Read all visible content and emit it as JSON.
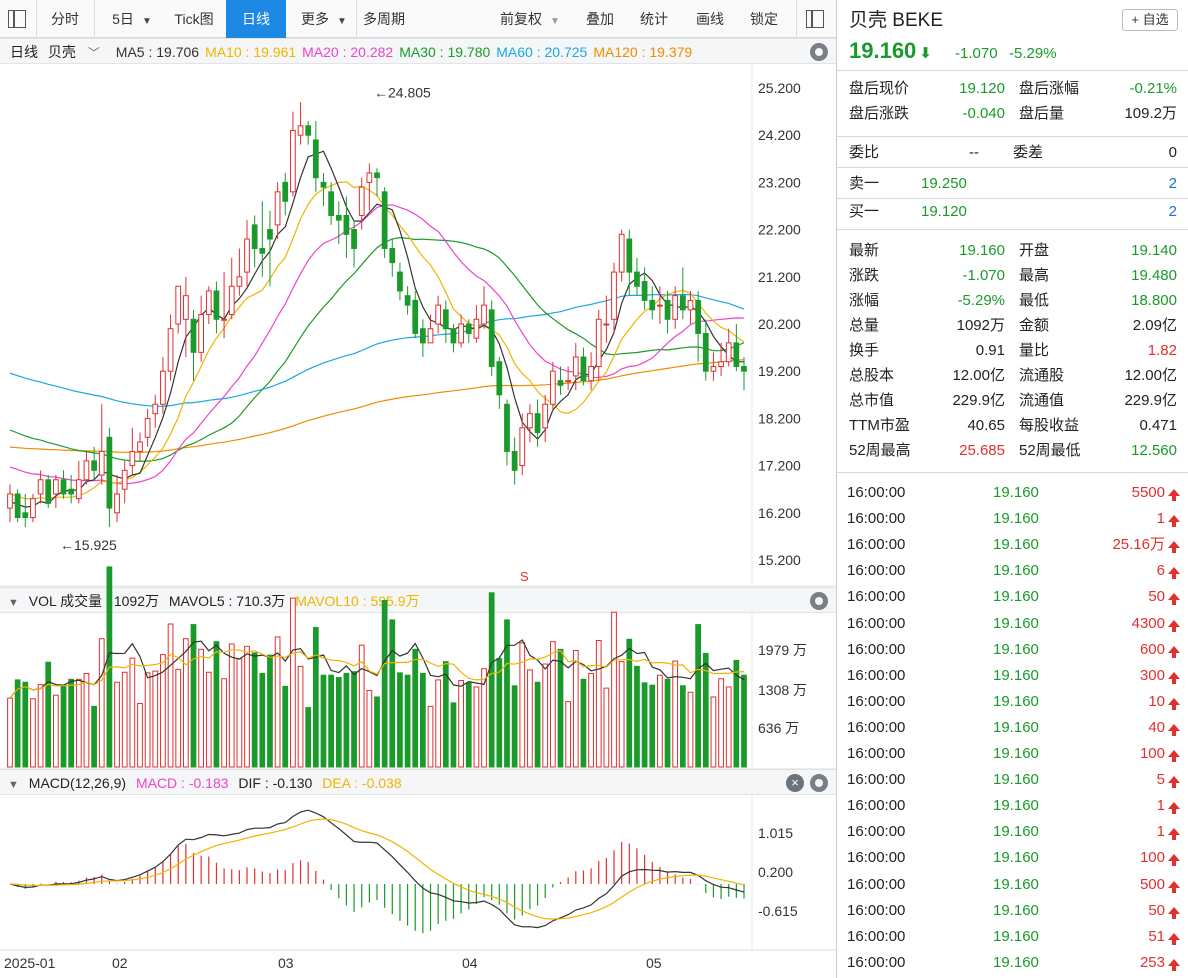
{
  "toolbar": {
    "items": [
      "分时",
      "5日",
      "Tick图",
      "日线",
      "更多",
      "多周期",
      "前复权",
      "叠加",
      "统计",
      "画线",
      "锁定"
    ],
    "active": "日线"
  },
  "kline": {
    "period_label": "日线",
    "stock_label": "贝壳",
    "ma": [
      {
        "label": "MA5 : 19.706",
        "color": "#333333"
      },
      {
        "label": "MA10 : 19.961",
        "color": "#f0b400"
      },
      {
        "label": "MA20 : 20.282",
        "color": "#ee44cc"
      },
      {
        "label": "MA30 : 19.780",
        "color": "#1a9a2a"
      },
      {
        "label": "MA60 : 20.725",
        "color": "#1ba8e0"
      },
      {
        "label": "MA120 : 19.379",
        "color": "#f08c00"
      }
    ],
    "price_ticks": [
      "25.200",
      "24.200",
      "23.200",
      "22.200",
      "21.200",
      "20.200",
      "19.200",
      "18.200",
      "17.200",
      "16.200",
      "15.200"
    ],
    "high_note": "←24.805",
    "low_note": "←15.925",
    "s_marker": "S"
  },
  "vol": {
    "title": "VOL 成交量 : 1092万",
    "mavol5": "MAVOL5 : 710.3万",
    "mavol10": "MAVOL10 : 595.9万",
    "ticks": [
      "1979 万",
      "1308 万",
      "636 万"
    ]
  },
  "macd": {
    "title": "MACD(12,26,9)",
    "macd": "MACD : -0.183",
    "dif": "DIF : -0.130",
    "dea": "DEA : -0.038",
    "ticks": [
      "1.015",
      "0.200",
      "-0.615"
    ]
  },
  "x_labels": [
    "2025-01",
    "02",
    "03",
    "04",
    "05"
  ],
  "colors": {
    "up": "#e03030",
    "down": "#1a9a2a",
    "accent": "#1e88e5"
  },
  "chart_data": {
    "type": "candlestick",
    "ylim": [
      15.2,
      25.2
    ],
    "candles": [
      [
        16.3,
        16.6,
        16.8,
        16.0
      ],
      [
        16.6,
        16.1,
        16.7,
        16.0
      ],
      [
        16.2,
        16.1,
        16.6,
        15.9
      ],
      [
        16.1,
        16.5,
        16.6,
        16.0
      ],
      [
        16.6,
        16.9,
        17.1,
        16.4
      ],
      [
        16.9,
        16.4,
        17.0,
        16.3
      ],
      [
        16.6,
        16.9,
        17.0,
        16.3
      ],
      [
        16.9,
        16.6,
        17.1,
        16.5
      ],
      [
        16.7,
        16.6,
        17.0,
        16.4
      ],
      [
        16.5,
        16.9,
        17.3,
        16.4
      ],
      [
        16.9,
        17.3,
        17.5,
        16.8
      ],
      [
        17.3,
        17.1,
        17.6,
        16.9
      ],
      [
        17.0,
        17.5,
        18.5,
        16.8
      ],
      [
        17.8,
        16.3,
        18.0,
        15.9
      ],
      [
        16.2,
        16.6,
        17.0,
        16.0
      ],
      [
        16.7,
        17.1,
        17.3,
        16.4
      ],
      [
        17.2,
        17.5,
        18.0,
        17.0
      ],
      [
        17.5,
        17.7,
        17.9,
        17.3
      ],
      [
        17.8,
        18.2,
        18.4,
        17.6
      ],
      [
        18.3,
        18.5,
        18.7,
        18.0
      ],
      [
        18.5,
        19.2,
        19.5,
        18.3
      ],
      [
        19.2,
        20.1,
        20.4,
        19.0
      ],
      [
        20.2,
        21.0,
        21.0,
        20.0
      ],
      [
        20.3,
        20.8,
        21.2,
        19.5
      ],
      [
        20.3,
        19.6,
        20.5,
        19.0
      ],
      [
        19.6,
        20.4,
        20.8,
        19.4
      ],
      [
        20.4,
        20.9,
        21.0,
        20.2
      ],
      [
        20.9,
        20.3,
        21.1,
        20.0
      ],
      [
        20.3,
        20.3,
        21.3,
        19.9
      ],
      [
        20.4,
        21.0,
        21.6,
        20.3
      ],
      [
        21.0,
        21.2,
        21.8,
        20.8
      ],
      [
        21.3,
        22.0,
        22.4,
        21.0
      ],
      [
        22.3,
        21.8,
        22.5,
        21.4
      ],
      [
        21.8,
        21.7,
        22.8,
        21.2
      ],
      [
        22.2,
        22.0,
        22.6,
        21.0
      ],
      [
        22.3,
        23.0,
        23.2,
        22.0
      ],
      [
        23.2,
        22.8,
        23.4,
        22.5
      ],
      [
        23.0,
        24.3,
        24.7,
        22.9
      ],
      [
        24.2,
        24.4,
        24.9,
        24.0
      ],
      [
        24.4,
        24.2,
        24.5,
        24.0
      ],
      [
        24.1,
        23.3,
        24.5,
        23.0
      ],
      [
        23.2,
        23.1,
        23.4,
        22.7
      ],
      [
        23.0,
        22.5,
        23.2,
        22.3
      ],
      [
        22.5,
        22.4,
        22.8,
        21.9
      ],
      [
        22.5,
        22.1,
        22.9,
        21.6
      ],
      [
        22.2,
        21.8,
        22.4,
        21.4
      ],
      [
        22.5,
        23.1,
        23.3,
        22.2
      ],
      [
        23.2,
        23.4,
        23.6,
        22.6
      ],
      [
        23.4,
        23.3,
        23.5,
        22.9
      ],
      [
        23.0,
        21.8,
        23.1,
        21.6
      ],
      [
        21.8,
        21.5,
        22.0,
        21.2
      ],
      [
        21.3,
        20.9,
        21.5,
        20.7
      ],
      [
        20.8,
        20.6,
        21.0,
        20.4
      ],
      [
        20.7,
        20.0,
        20.9,
        19.9
      ],
      [
        20.1,
        19.8,
        20.3,
        19.5
      ],
      [
        19.8,
        20.1,
        20.4,
        19.8
      ],
      [
        20.2,
        20.6,
        20.8,
        20.0
      ],
      [
        20.5,
        20.1,
        20.7,
        19.8
      ],
      [
        20.1,
        19.8,
        20.2,
        19.6
      ],
      [
        19.8,
        20.2,
        20.4,
        19.7
      ],
      [
        20.2,
        20.0,
        20.3,
        19.8
      ],
      [
        19.9,
        20.3,
        20.6,
        19.8
      ],
      [
        20.2,
        20.6,
        21.0,
        20.1
      ],
      [
        20.5,
        19.3,
        20.7,
        19.1
      ],
      [
        19.4,
        18.7,
        19.5,
        18.4
      ],
      [
        18.5,
        17.5,
        18.6,
        17.2
      ],
      [
        17.5,
        17.1,
        17.8,
        16.8
      ],
      [
        17.2,
        18.0,
        18.3,
        17.0
      ],
      [
        18.0,
        18.3,
        18.5,
        17.7
      ],
      [
        18.3,
        17.9,
        18.6,
        17.6
      ],
      [
        18.0,
        18.5,
        18.7,
        17.7
      ],
      [
        18.5,
        19.2,
        19.4,
        18.4
      ],
      [
        19.0,
        18.9,
        19.3,
        18.7
      ],
      [
        19.0,
        19.0,
        19.3,
        18.8
      ],
      [
        19.1,
        19.5,
        19.8,
        18.8
      ],
      [
        19.5,
        19.0,
        19.7,
        18.9
      ],
      [
        19.0,
        19.3,
        19.6,
        18.8
      ],
      [
        19.3,
        20.3,
        20.5,
        19.0
      ],
      [
        20.2,
        20.2,
        20.8,
        19.8
      ],
      [
        20.3,
        21.3,
        21.5,
        20.0
      ],
      [
        21.3,
        22.1,
        22.2,
        21.1
      ],
      [
        22.0,
        21.3,
        22.2,
        20.8
      ],
      [
        21.3,
        21.0,
        21.6,
        20.8
      ],
      [
        21.1,
        20.7,
        21.4,
        20.5
      ],
      [
        20.7,
        20.5,
        21.0,
        20.3
      ],
      [
        20.6,
        20.6,
        21.0,
        20.2
      ],
      [
        20.7,
        20.3,
        20.9,
        20.0
      ],
      [
        20.3,
        20.8,
        21.0,
        20.1
      ],
      [
        20.8,
        20.5,
        21.4,
        20.3
      ],
      [
        20.5,
        20.7,
        20.9,
        20.2
      ],
      [
        20.7,
        20.0,
        20.9,
        19.4
      ],
      [
        20.0,
        19.2,
        20.3,
        19.0
      ],
      [
        19.2,
        19.3,
        19.6,
        19.0
      ],
      [
        19.3,
        19.4,
        19.8,
        19.1
      ],
      [
        19.4,
        19.8,
        20.1,
        19.3
      ],
      [
        19.8,
        19.3,
        20.2,
        19.2
      ],
      [
        19.3,
        19.2,
        19.5,
        18.8
      ]
    ],
    "volume_ticks": [
      1979,
      1308,
      636
    ]
  },
  "panel": {
    "name": "贝壳",
    "symbol": "BEKE",
    "add_fav": "+ 自选",
    "price": "19.160",
    "change": "-1.070",
    "change_pct": "-5.29%",
    "after": [
      {
        "l1": "盘后现价",
        "v1": "19.120",
        "c1": "green",
        "l2": "盘后涨幅",
        "v2": "-0.21%",
        "c2": "green"
      },
      {
        "l1": "盘后涨跌",
        "v1": "-0.040",
        "c1": "green",
        "l2": "盘后量",
        "v2": "109.2万",
        "c2": ""
      }
    ],
    "weibi": {
      "l1": "委比",
      "v1": "--",
      "l2": "委差",
      "v2": "0"
    },
    "sell1": {
      "label": "卖一",
      "price": "19.250",
      "vol": "2"
    },
    "buy1": {
      "label": "买一",
      "price": "19.120",
      "vol": "2"
    },
    "stats": [
      {
        "l1": "最新",
        "v1": "19.160",
        "c1": "green",
        "l2": "开盘",
        "v2": "19.140",
        "c2": "green"
      },
      {
        "l1": "涨跌",
        "v1": "-1.070",
        "c1": "green",
        "l2": "最高",
        "v2": "19.480",
        "c2": "green"
      },
      {
        "l1": "涨幅",
        "v1": "-5.29%",
        "c1": "green",
        "l2": "最低",
        "v2": "18.800",
        "c2": "green"
      },
      {
        "l1": "总量",
        "v1": "1092万",
        "c1": "",
        "l2": "金额",
        "v2": "2.09亿",
        "c2": ""
      },
      {
        "l1": "换手",
        "v1": "0.91",
        "c1": "",
        "l2": "量比",
        "v2": "1.82",
        "c2": "red"
      },
      {
        "l1": "总股本",
        "v1": "12.00亿",
        "c1": "",
        "l2": "流通股",
        "v2": "12.00亿",
        "c2": ""
      },
      {
        "l1": "总市值",
        "v1": "229.9亿",
        "c1": "",
        "l2": "流通值",
        "v2": "229.9亿",
        "c2": ""
      },
      {
        "l1": "TTM市盈",
        "v1": "40.65",
        "c1": "",
        "l2": "每股收益",
        "v2": "0.471",
        "c2": ""
      },
      {
        "l1": "52周最高",
        "v1": "25.685",
        "c1": "red",
        "l2": "52周最低",
        "v2": "12.560",
        "c2": "green"
      }
    ],
    "ticks": [
      {
        "time": "16:00:00",
        "price": "19.160",
        "vol": "5500"
      },
      {
        "time": "16:00:00",
        "price": "19.160",
        "vol": "1"
      },
      {
        "time": "16:00:00",
        "price": "19.160",
        "vol": "25.16万"
      },
      {
        "time": "16:00:00",
        "price": "19.160",
        "vol": "6"
      },
      {
        "time": "16:00:00",
        "price": "19.160",
        "vol": "50"
      },
      {
        "time": "16:00:00",
        "price": "19.160",
        "vol": "4300"
      },
      {
        "time": "16:00:00",
        "price": "19.160",
        "vol": "600"
      },
      {
        "time": "16:00:00",
        "price": "19.160",
        "vol": "300"
      },
      {
        "time": "16:00:00",
        "price": "19.160",
        "vol": "10"
      },
      {
        "time": "16:00:00",
        "price": "19.160",
        "vol": "40"
      },
      {
        "time": "16:00:00",
        "price": "19.160",
        "vol": "100"
      },
      {
        "time": "16:00:00",
        "price": "19.160",
        "vol": "5"
      },
      {
        "time": "16:00:00",
        "price": "19.160",
        "vol": "1"
      },
      {
        "time": "16:00:00",
        "price": "19.160",
        "vol": "1"
      },
      {
        "time": "16:00:00",
        "price": "19.160",
        "vol": "100"
      },
      {
        "time": "16:00:00",
        "price": "19.160",
        "vol": "500"
      },
      {
        "time": "16:00:00",
        "price": "19.160",
        "vol": "50"
      },
      {
        "time": "16:00:00",
        "price": "19.160",
        "vol": "51"
      },
      {
        "time": "16:00:00",
        "price": "19.160",
        "vol": "253"
      }
    ]
  }
}
